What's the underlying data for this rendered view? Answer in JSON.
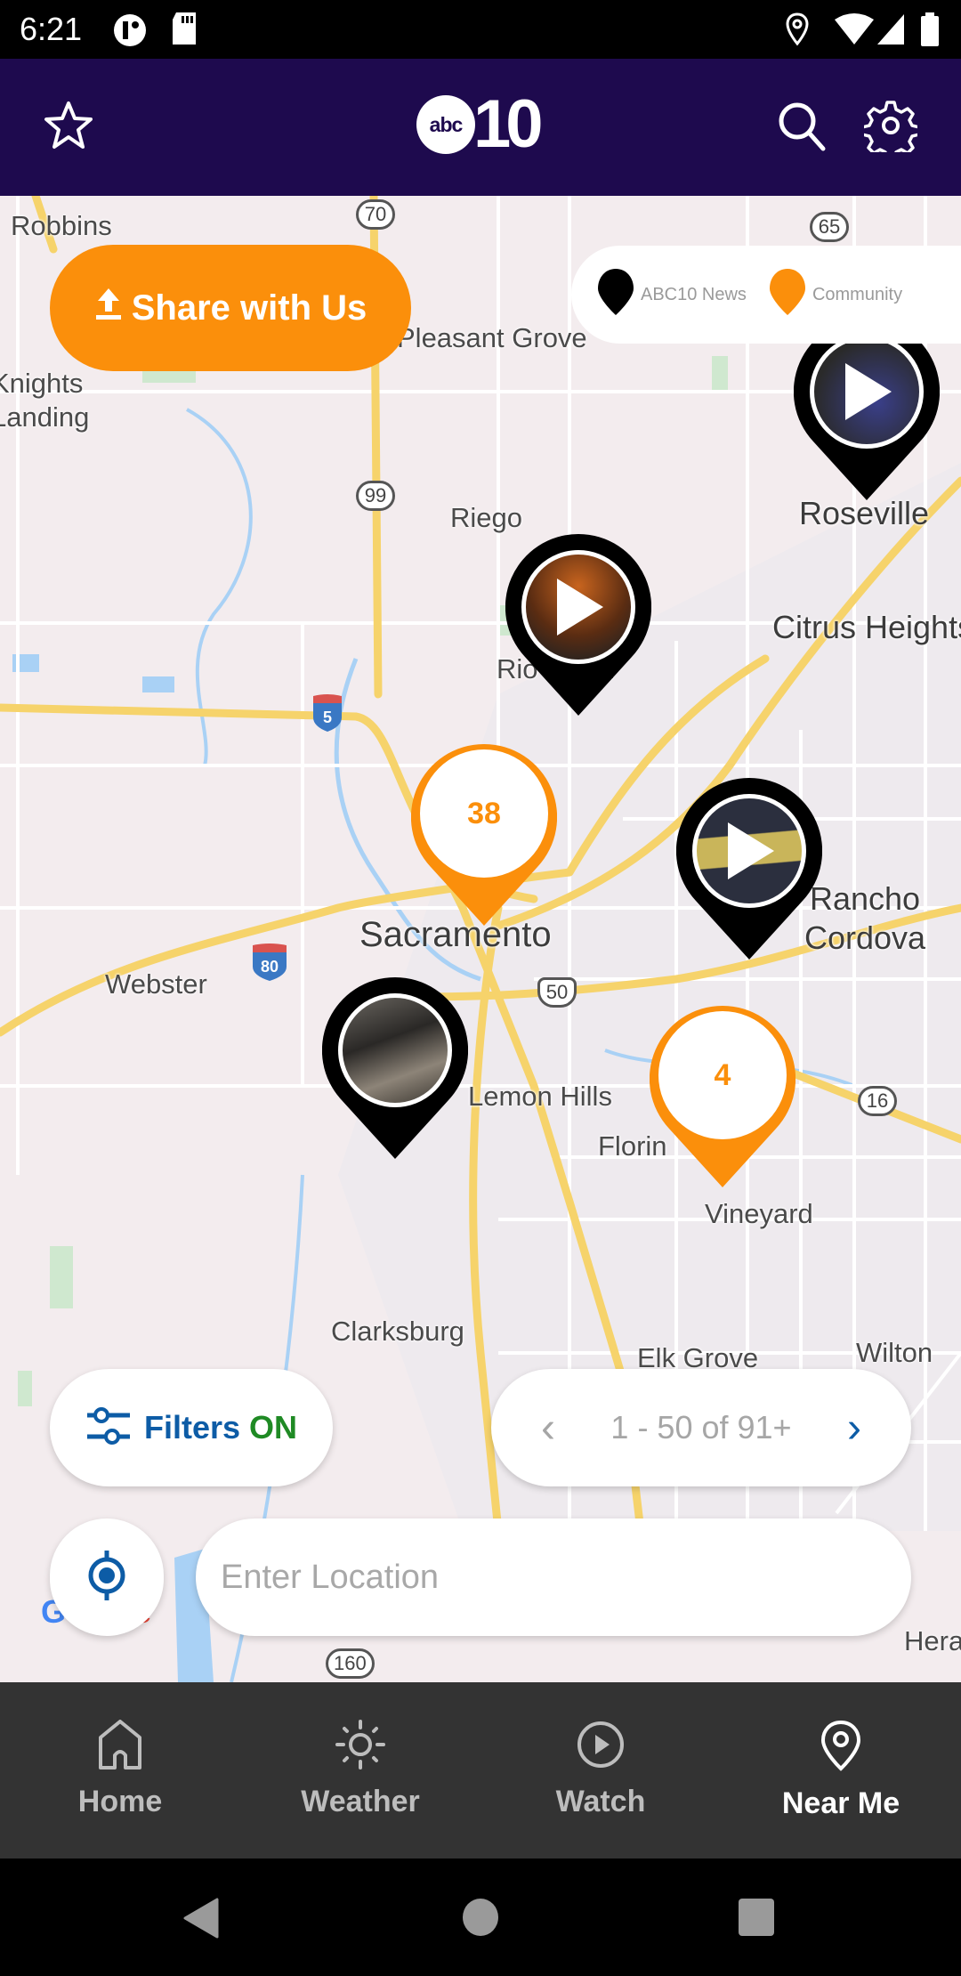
{
  "status_bar": {
    "time": "6:21",
    "left_icons": [
      "app-notification-icon",
      "sd-card-icon"
    ],
    "right_icons": [
      "location-icon",
      "wifi-icon",
      "signal-icon",
      "battery-icon"
    ]
  },
  "header": {
    "logo_ball": "abc",
    "logo_number": "10",
    "left_icon": "star-icon",
    "right_icons": [
      "search-icon",
      "gear-icon"
    ]
  },
  "share": {
    "label": "Share with Us",
    "icon": "upload-icon"
  },
  "legend": {
    "items": [
      {
        "label": "ABC10 News",
        "color": "#000000"
      },
      {
        "label": "Community",
        "color": "#fb8f0b"
      }
    ]
  },
  "map": {
    "places": [
      {
        "name": "Robbins"
      },
      {
        "name": "Pleasant Grove"
      },
      {
        "name": "Knights Landing"
      },
      {
        "name": "Riego"
      },
      {
        "name": "Roseville"
      },
      {
        "name": "Citrus Heights"
      },
      {
        "name": "Rio Linda"
      },
      {
        "name": "Sacramento"
      },
      {
        "name": "Rancho Cordova"
      },
      {
        "name": "Webster"
      },
      {
        "name": "Lemon Hills"
      },
      {
        "name": "Florin"
      },
      {
        "name": "Vineyard"
      },
      {
        "name": "Clarksburg"
      },
      {
        "name": "Elk Grove"
      },
      {
        "name": "Wilton"
      },
      {
        "name": "Herald"
      }
    ],
    "route_shields": [
      "70",
      "65",
      "99",
      "5",
      "80",
      "50",
      "16",
      "160"
    ],
    "attribution": "Google",
    "pins": [
      {
        "type": "news",
        "media": "video",
        "thumb_color": "#2a2f5a",
        "near": "Roseville"
      },
      {
        "type": "news",
        "media": "video",
        "thumb_color": "#5a2c12",
        "near": "Rio Linda"
      },
      {
        "type": "community-cluster",
        "count": "38",
        "near": "Sacramento"
      },
      {
        "type": "news",
        "media": "video",
        "thumb_color": "#2c2a22",
        "near": "Rancho Cordova"
      },
      {
        "type": "news",
        "media": "photo",
        "thumb_color": "#3a3630",
        "near": "Lemon Hills"
      },
      {
        "type": "community-cluster",
        "count": "4",
        "near": "Vineyard"
      }
    ]
  },
  "controls": {
    "filters_label": "Filters",
    "filters_state": "ON",
    "pager_text": "1 - 50 of 91+",
    "pager_prev": "‹",
    "pager_next": "›",
    "location_placeholder": "Enter Location",
    "location_value": ""
  },
  "bottom_nav": {
    "items": [
      {
        "label": "Home",
        "icon": "home-icon",
        "active": false
      },
      {
        "label": "Weather",
        "icon": "sun-icon",
        "active": false
      },
      {
        "label": "Watch",
        "icon": "play-circle-icon",
        "active": false
      },
      {
        "label": "Near Me",
        "icon": "map-pin-icon",
        "active": true
      }
    ]
  },
  "colors": {
    "header_bg": "#1e0a4e",
    "accent_orange": "#fb8f0b",
    "filters_blue": "#0d5ca6",
    "filters_on_green": "#1f8a24",
    "nav_bg": "#333333"
  }
}
